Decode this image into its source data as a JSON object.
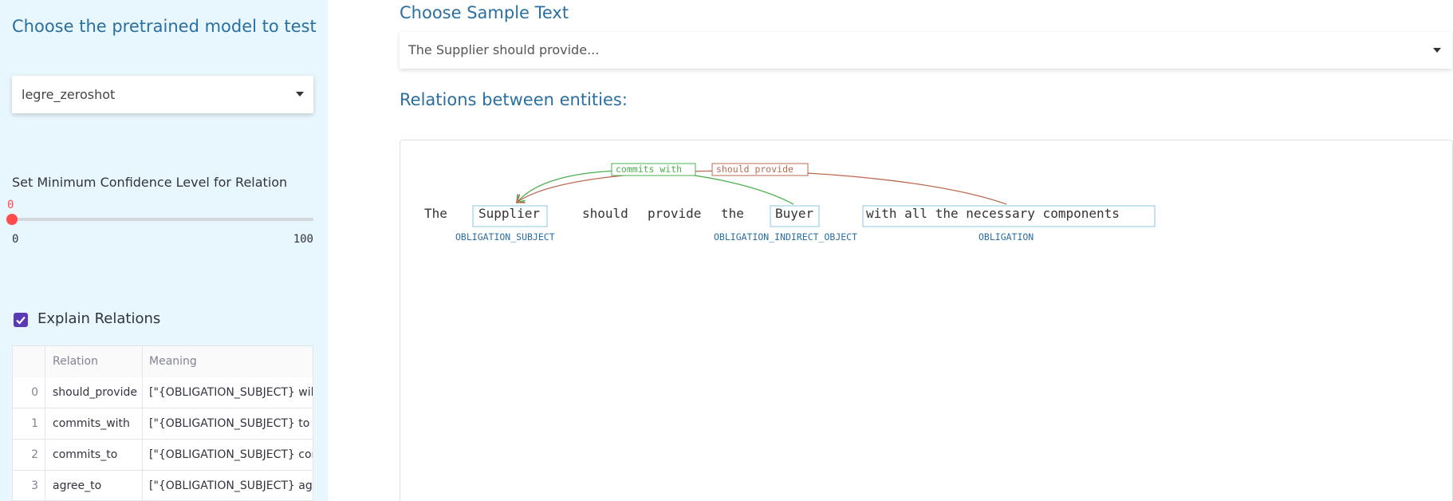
{
  "sidebar": {
    "title": "Choose the pretrained model to test",
    "model_select": {
      "value": "legre_zeroshot"
    },
    "slider": {
      "label": "Set Minimum Confidence Level for Relation",
      "value": "0",
      "min": "0",
      "max": "100"
    },
    "explain": {
      "label": "Explain Relations",
      "checked": true
    },
    "table": {
      "columns": [
        "",
        "Relation",
        "Meaning"
      ],
      "rows": [
        [
          "0",
          "should_provide",
          "[\"{OBLIGATION_SUBJECT} will p"
        ],
        [
          "1",
          "commits_with",
          "[\"{OBLIGATION_SUBJECT} to {O"
        ],
        [
          "2",
          "commits_to",
          "[\"{OBLIGATION_SUBJECT} comm"
        ],
        [
          "3",
          "agree_to",
          "[\"{OBLIGATION_SUBJECT} agre"
        ]
      ]
    }
  },
  "main": {
    "sample_heading": "Choose Sample Text",
    "sample_select": {
      "value": "The Supplier should provide..."
    },
    "relations_heading": "Relations between entities:"
  },
  "diagram": {
    "tokens": [
      {
        "text": "The",
        "entity": false
      },
      {
        "text": "Supplier",
        "entity": true,
        "label": "OBLIGATION_SUBJECT"
      },
      {
        "text": "should",
        "entity": false
      },
      {
        "text": "provide",
        "entity": false
      },
      {
        "text": "the",
        "entity": false
      },
      {
        "text": "Buyer",
        "entity": true,
        "label": "OBLIGATION_INDIRECT_OBJECT"
      },
      {
        "text": "with all the necessary components",
        "entity": true,
        "label": "OBLIGATION"
      }
    ],
    "relations": [
      {
        "label": "commits_with",
        "color": "#4caf50"
      },
      {
        "label": "should_provide",
        "color": "#b86b52"
      }
    ],
    "relation_display": [
      "commits with",
      "should provide"
    ],
    "entity_color": "#9fd0e6",
    "entity_label_color": "#2a6fa0"
  }
}
